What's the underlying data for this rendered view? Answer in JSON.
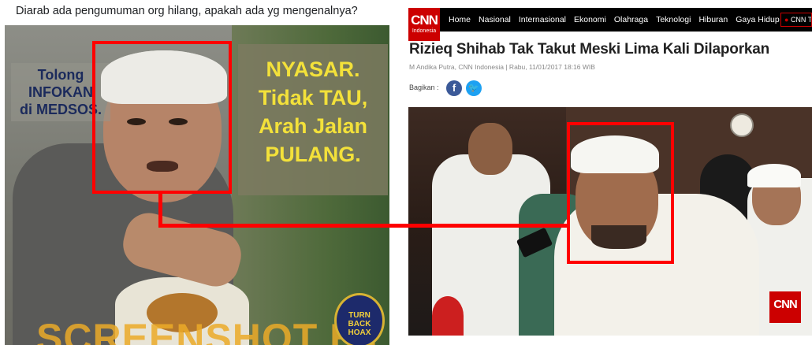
{
  "post": {
    "caption": "Diarab ada pengumuman org hilang, apakah ada yg mengenalnya?"
  },
  "meme": {
    "left_text": [
      "Tolong",
      "INFOKAN",
      "di MEDSOS."
    ],
    "right_text": [
      "NYASAR.",
      "Tidak TAU,",
      "Arah Jalan",
      "PULANG."
    ],
    "watermark": "SCREENSHOT BY",
    "badge_text": [
      "TURN",
      "BACK",
      "HOAX"
    ]
  },
  "article": {
    "site_logo": "CNN",
    "site_logo_sub": "Indonesia",
    "nav": [
      "Home",
      "Nasional",
      "Internasional",
      "Ekonomi",
      "Olahraga",
      "Teknologi",
      "Hiburan",
      "Gaya Hidup"
    ],
    "nav_tv": "CNN T",
    "headline": "Rizieq Shihab Tak Takut Meski Lima Kali Dilaporkan",
    "byline": "M Andika Putra, CNN Indonesia | Rabu, 11/01/2017 18:16 WIB",
    "share_label": "Bagikan :",
    "photo_logo": "CNN"
  },
  "colors": {
    "highlight": "#ff0000",
    "cnn_red": "#cc0000",
    "meme_yellow": "#f3e13a",
    "facebook": "#3b5998",
    "twitter": "#1da1f2"
  },
  "icons": [
    "facebook-icon",
    "twitter-icon"
  ]
}
